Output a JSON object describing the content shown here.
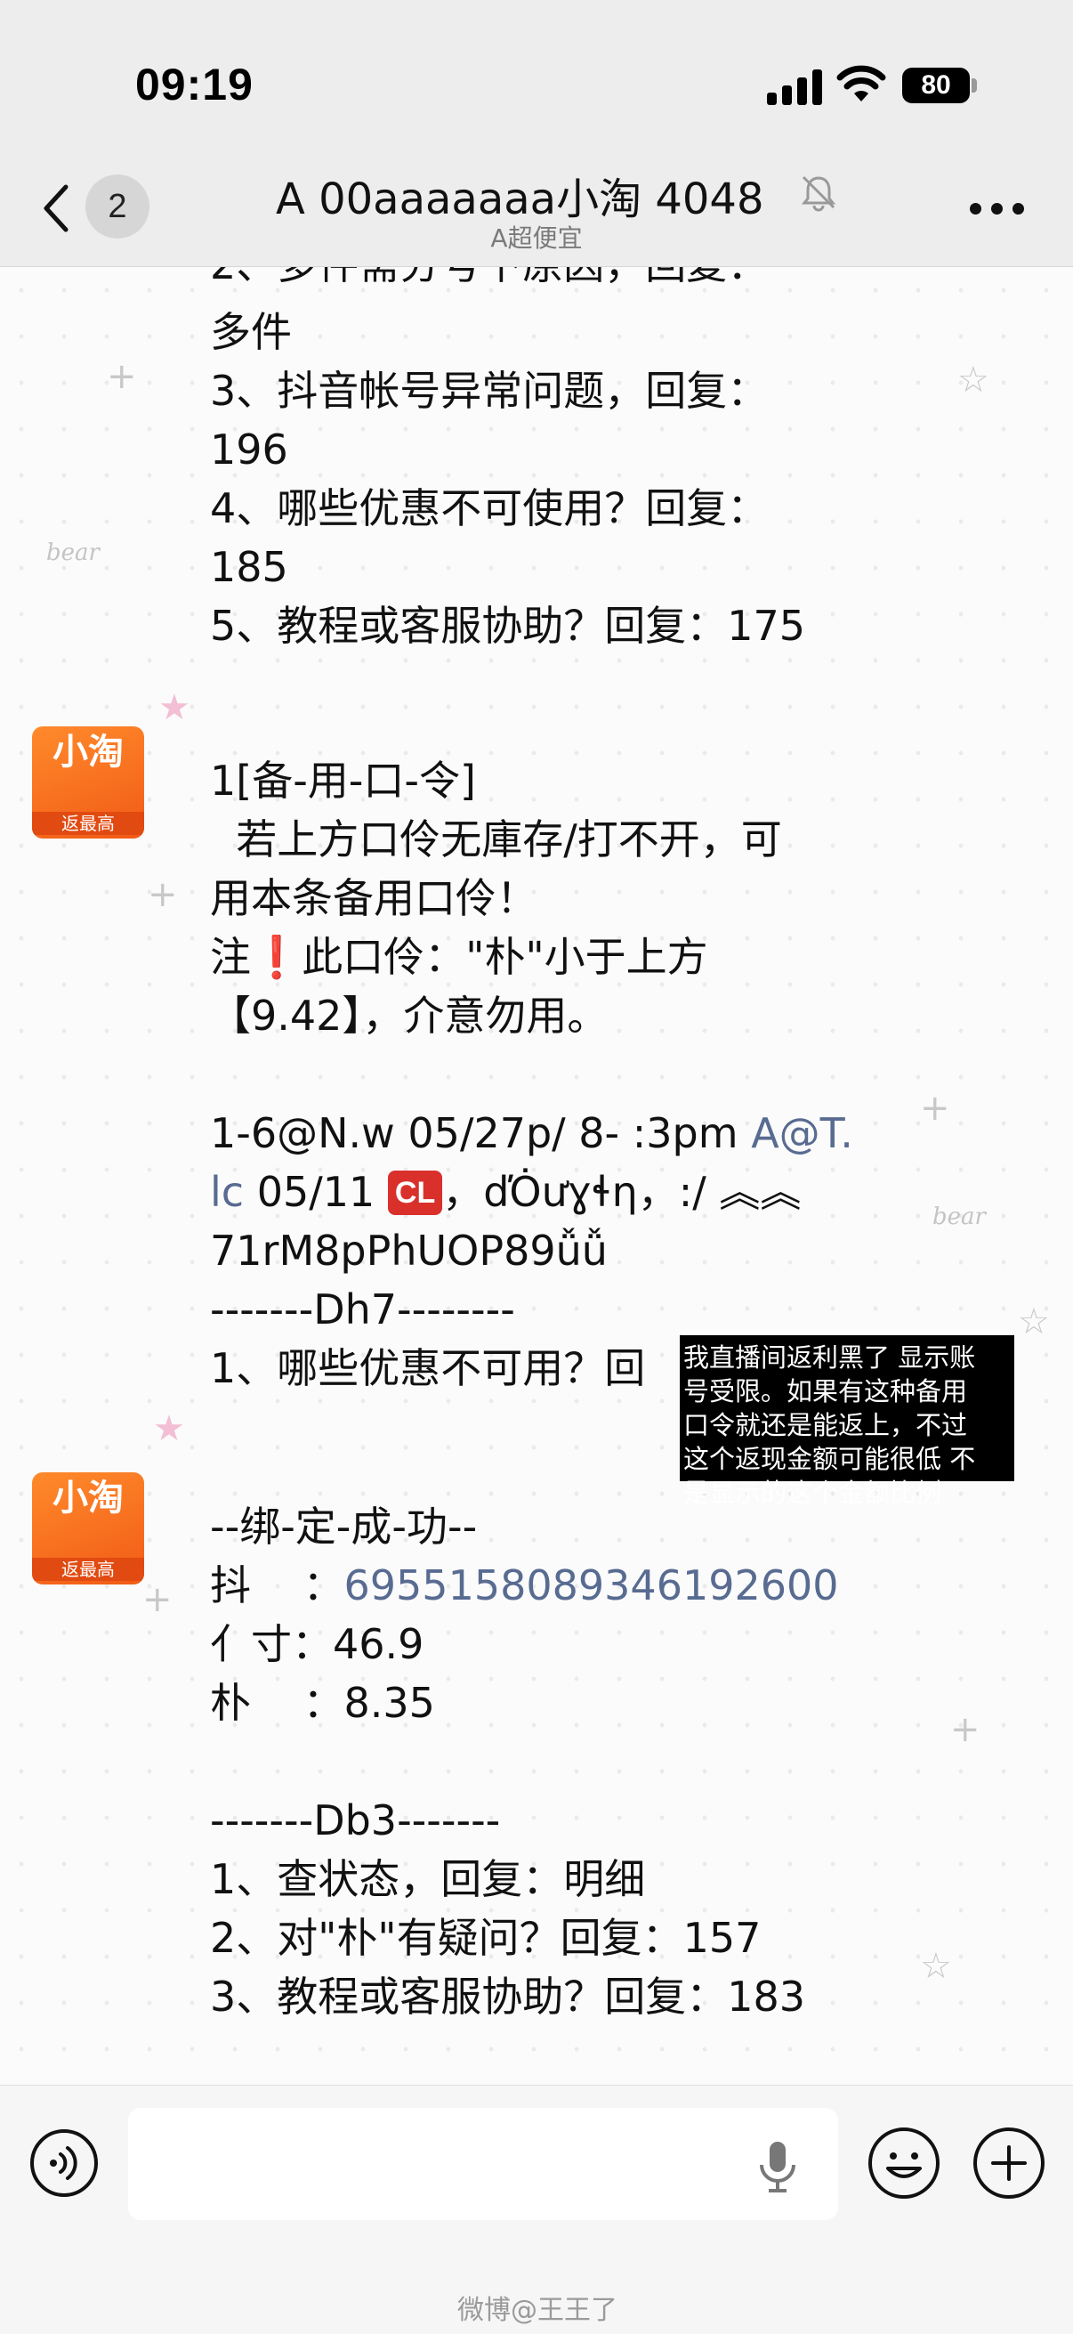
{
  "status_bar": {
    "time": "09:19",
    "battery": "80"
  },
  "header": {
    "unread_count": "2",
    "title": "A 00aaaaaaa小淘 4048",
    "subtitle": "A超便宜"
  },
  "messages": {
    "m1_partial_line": "2、多件需分号下原因，回复：",
    "m1_lines": "多件\n3、抖音帐号异常问题，回复：\n196\n4、哪些优惠不可使用？回复：\n185\n5、教程或客服协助？回复：175",
    "avatar_big": "小淘",
    "avatar_small": "返最高",
    "m2_head": "1[备-用-口-令]\n  若上方口伶无庫存/打不开，可\n用本条备用口伶！",
    "m2_note_prefix": "注",
    "m2_note_bang": "❗",
    "m2_note_rest": "此口伶：\"朴\"小于上方\n【9.42】，介意勿用。",
    "m2_code_a": "1-6@N.w 05/27p/ 8- :3pm ",
    "m2_code_link1": "A@T.",
    "m2_code_link2": "lc",
    "m2_code_b": " 05/11 ",
    "m2_cl": "CL",
    "m2_code_c": "，ďȮưɣɬη，:/ ︽︽\n71rM8pPhUOP89ǚǚ\n-------Dh7--------\n1、哪些优惠不可用？回",
    "m3_title": "--绑-定-成-功--",
    "m3_dou_label": "抖    ：",
    "m3_dou_value": "6955158089346192600",
    "m3_rest": "亻寸：46.9\n朴    ：8.35\n\n-------Db3-------\n1、查状态，回复：明细\n2、对\"朴\"有疑问？回复：157\n3、教程或客服协助？回复：183"
  },
  "overlay_note": "我直播间返利黑了 显示账\n号受限。如果有这种备用\n口令就还是能返上，不过\n这个返现金额可能很低 不\n是显示的这个金额比例",
  "decorations": {
    "bear": "bear"
  },
  "watermark": "微博@王王了",
  "icons": {
    "back": "chevron-left-icon",
    "mute": "bell-slash-icon",
    "more": "ellipsis-icon",
    "voice": "voice-icon",
    "mic": "mic-icon",
    "emoji": "emoji-icon",
    "plus": "plus-icon"
  }
}
